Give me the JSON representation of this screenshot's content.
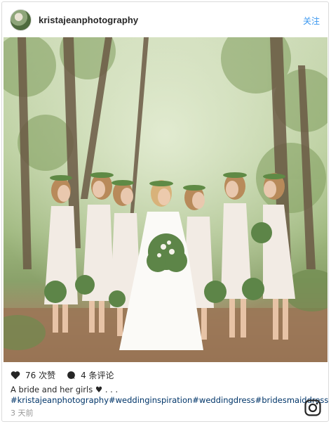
{
  "header": {
    "username": "kristajeanphotography",
    "follow_label": "关注"
  },
  "post": {
    "likes_text": "76 次赞",
    "comments_text": "4 条评论",
    "caption": "A bride and her girls ♥ . . .",
    "hashtags": "#kristajeanphotography#weddinginspiration#weddingdress#bridesmaiddresses#bride",
    "timestamp": "3 天前"
  },
  "icons": {
    "avatar": "avatar",
    "like": "heart-icon",
    "comment": "comment-bubble-icon",
    "brand": "instagram-icon"
  },
  "colors": {
    "link": "#3897f0",
    "hashtag": "#003569",
    "meta": "#999999"
  }
}
